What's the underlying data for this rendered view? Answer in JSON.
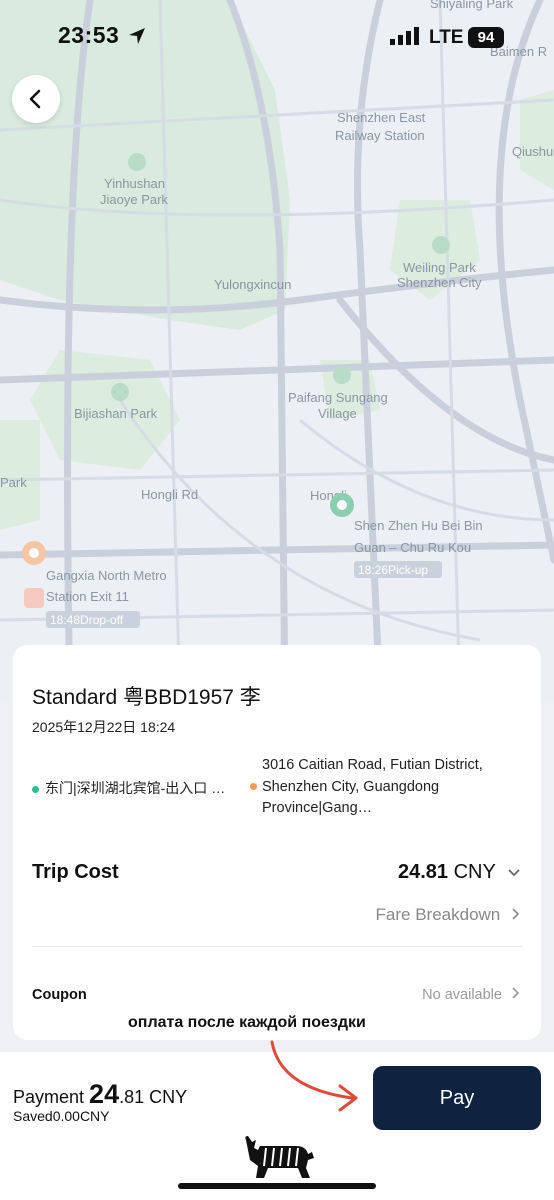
{
  "status_bar": {
    "time": "23:53",
    "network": "LTE",
    "battery": "94"
  },
  "map": {
    "labels": {
      "top_right_1": "Shiyaling Park",
      "top_right_2": "Baimen R",
      "station_1": "Shenzhen East",
      "station_2": "Railway Station",
      "qiushu": "Qiushu",
      "park_yinhu_1": "Yinhushan",
      "park_yinhu_2": "Jiaoye Park",
      "weiling_1": "Weiling Park",
      "weiling_2": "Shenzhen City",
      "yulong": "Yulongxincun",
      "paifang_1": "Paifang Sungang",
      "paifang_2": "Village",
      "bijiashan": "Bijiashan Park",
      "park_left": "Park",
      "hongli": "Hongli Rd",
      "hongli_2": "Hongli",
      "pickup_1": "Shen Zhen Hu Bei Bin",
      "pickup_2": "Guan – Chu Ru Kou",
      "pickup_time": "18:26Pick-up",
      "drop_1": "Gangxia North Metro",
      "drop_2": "Station Exit 11",
      "drop_time": "18:48Drop-off"
    }
  },
  "trip": {
    "title": "Standard  粤BBD1957  李",
    "date": "2025年12月22日 18:24",
    "pickup_address": "东门|深圳湖北宾馆-出入口 …",
    "dropoff_address": "3016 Caitian Road, Futian District, Shenzhen City, Guangdong Province|Gang…"
  },
  "cost": {
    "label": "Trip Cost",
    "amount": "24.81",
    "currency": " CNY",
    "fare_breakdown": "Fare Breakdown"
  },
  "coupon": {
    "label": "Coupon",
    "value": "No available"
  },
  "annotation": "оплата после каждой поездки",
  "payment": {
    "label": "Payment ",
    "amount_int": "24",
    "amount_dec": ".81",
    "currency": " CNY",
    "saved": "Saved0.00CNY",
    "pay_button": "Pay"
  },
  "colors": {
    "accent": "#0f2240",
    "pickup_dot": "#2fbf8f",
    "dropoff_dot": "#f59a4c",
    "annotation_arrow": "#e04a3a"
  }
}
